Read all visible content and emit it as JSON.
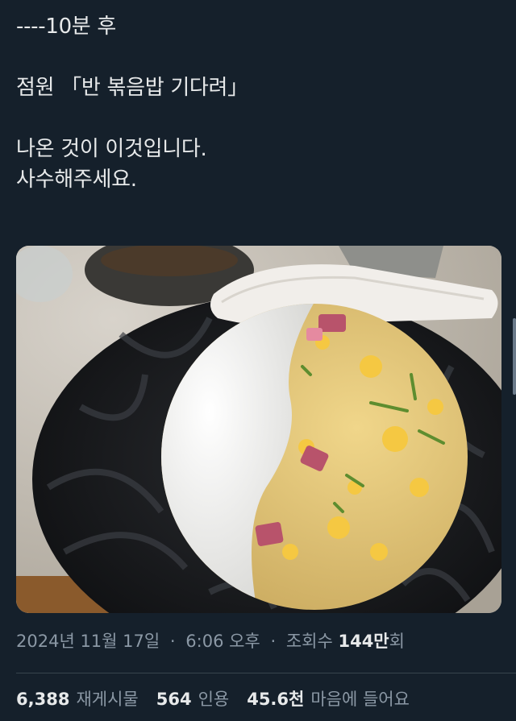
{
  "tweet": {
    "lines": [
      "----10분 후",
      "",
      "점원 「반 볶음밥 기다려」",
      "",
      "나온 것이 이것입니다.",
      "사수해주세요."
    ]
  },
  "meta": {
    "date": "2024년 11월 17일",
    "separator": "·",
    "time": "6:06 오후",
    "views_label_prefix": "조회수",
    "views_number": "144만",
    "views_suffix": "회"
  },
  "stats": {
    "retweets_count": "6,388",
    "retweets_label": "재게시물",
    "quotes_count": "564",
    "quotes_label": "인용",
    "likes_count": "45.6천",
    "likes_label": "마음에 들어요"
  },
  "colors": {
    "background": "#15202b",
    "text_primary": "#e7e9ea",
    "text_secondary": "#8b98a5",
    "divider": "#38444d"
  }
}
